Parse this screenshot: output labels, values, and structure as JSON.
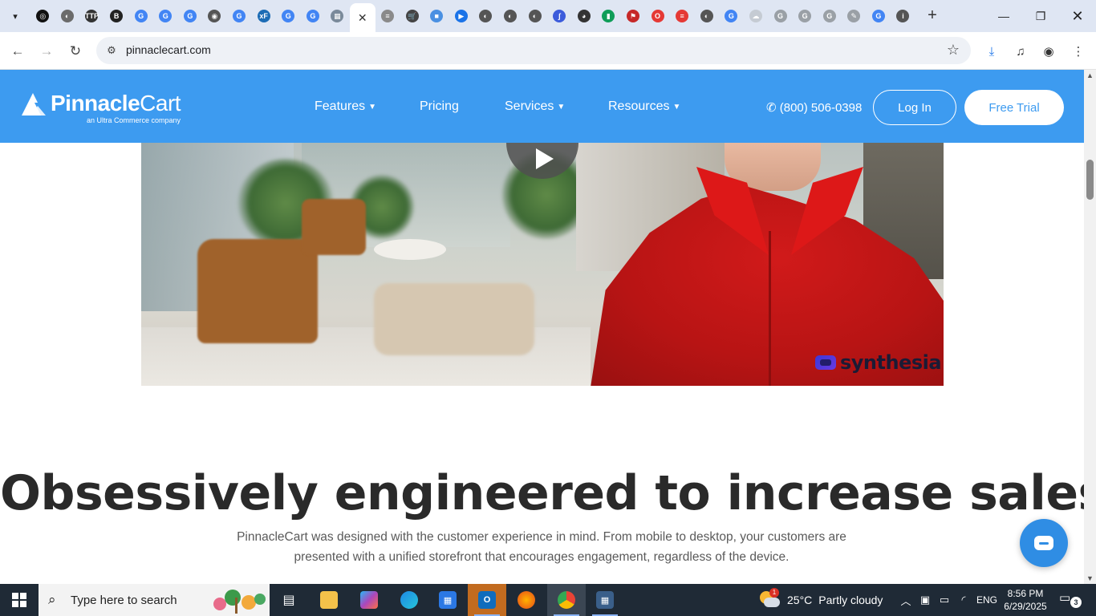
{
  "browser": {
    "url": "pinnaclecart.com",
    "tab_favicons": [
      {
        "name": "chatgpt",
        "color": "#111111",
        "glyph": "◎"
      },
      {
        "name": "globe",
        "color": "#6b6b6b",
        "glyph": "◐"
      },
      {
        "name": "ttp",
        "color": "#333333",
        "glyph": "TTP"
      },
      {
        "name": "b-logo",
        "color": "#222222",
        "glyph": "B"
      },
      {
        "name": "google",
        "color": "#4285f4",
        "glyph": "G"
      },
      {
        "name": "google",
        "color": "#4285f4",
        "glyph": "G"
      },
      {
        "name": "google",
        "color": "#4285f4",
        "glyph": "G"
      },
      {
        "name": "globe-dark",
        "color": "#555555",
        "glyph": "◉"
      },
      {
        "name": "google",
        "color": "#4285f4",
        "glyph": "G"
      },
      {
        "name": "xf",
        "color": "#1c6cb5",
        "glyph": "xF"
      },
      {
        "name": "google",
        "color": "#4285f4",
        "glyph": "G"
      },
      {
        "name": "google",
        "color": "#4285f4",
        "glyph": "G"
      },
      {
        "name": "doc",
        "color": "#7a8a9a",
        "glyph": "▦"
      }
    ],
    "tab_favicons_after": [
      {
        "name": "chat",
        "color": "#8a8a8a",
        "glyph": "≡"
      },
      {
        "name": "cart",
        "color": "#444444",
        "glyph": "🛒"
      },
      {
        "name": "folder",
        "color": "#4a90e2",
        "glyph": "■"
      },
      {
        "name": "flag",
        "color": "#1a73e8",
        "glyph": "▶"
      },
      {
        "name": "globe",
        "color": "#555555",
        "glyph": "◐"
      },
      {
        "name": "globe",
        "color": "#555555",
        "glyph": "◐"
      },
      {
        "name": "globe",
        "color": "#555555",
        "glyph": "◐"
      },
      {
        "name": "chart",
        "color": "#3b5bdb",
        "glyph": "∫"
      },
      {
        "name": "eye",
        "color": "#333333",
        "glyph": "◕"
      },
      {
        "name": "analytics",
        "color": "#0f9d58",
        "glyph": "▮"
      },
      {
        "name": "flag-red",
        "color": "#c62828",
        "glyph": "⚑"
      },
      {
        "name": "opera",
        "color": "#e53935",
        "glyph": "O"
      },
      {
        "name": "stripes",
        "color": "#e53935",
        "glyph": "≡"
      },
      {
        "name": "globe",
        "color": "#555555",
        "glyph": "◐"
      },
      {
        "name": "google",
        "color": "#4285f4",
        "glyph": "G"
      },
      {
        "name": "cloud",
        "color": "#c5cbd3",
        "glyph": "☁"
      },
      {
        "name": "google",
        "color": "#9aa0a6",
        "glyph": "G"
      },
      {
        "name": "google",
        "color": "#9aa0a6",
        "glyph": "G"
      },
      {
        "name": "google",
        "color": "#9aa0a6",
        "glyph": "G"
      },
      {
        "name": "pen",
        "color": "#9aa0a6",
        "glyph": "✎"
      },
      {
        "name": "google",
        "color": "#4285f4",
        "glyph": "G"
      },
      {
        "name": "info",
        "color": "#555555",
        "glyph": "i"
      }
    ]
  },
  "site": {
    "logo_main": "Pinnacle",
    "logo_secondary": "Cart",
    "logo_tagline": "an Ultra Commerce company",
    "nav": [
      {
        "label": "Features",
        "dropdown": true
      },
      {
        "label": "Pricing",
        "dropdown": false
      },
      {
        "label": "Services",
        "dropdown": true
      },
      {
        "label": "Resources",
        "dropdown": true
      }
    ],
    "phone": "(800) 506-0398",
    "login_label": "Log In",
    "trial_label": "Free Trial",
    "brand_color": "#3d9bf0"
  },
  "video": {
    "watermark": "synthesia"
  },
  "hero": {
    "headline": "Obsessively engineered to increase sales",
    "subtext": "PinnacleCart was designed with the customer experience in mind. From mobile to desktop, your customers are presented with a unified storefront that encourages engagement, regardless of the device."
  },
  "taskbar": {
    "search_placeholder": "Type here to search",
    "weather_temp": "25°C",
    "weather_desc": "Partly cloudy",
    "language": "ENG",
    "time": "8:56 PM",
    "date": "6/29/2025",
    "notification_count": "3",
    "weather_badge": "1"
  }
}
